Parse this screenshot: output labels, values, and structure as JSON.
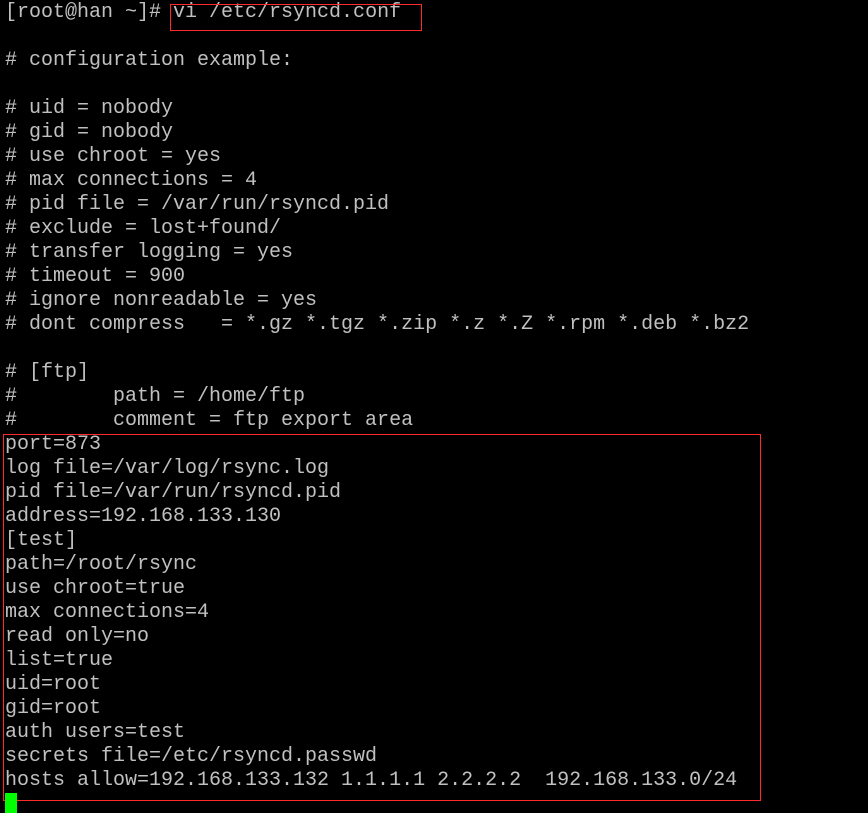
{
  "terminal": {
    "background": "#000000",
    "foreground": "#c0c0c0",
    "cursor_color": "#00ff00",
    "highlight_color": "#ff2a2a",
    "prompt": "[root@han ~]# ",
    "command": "vi /etc/rsyncd.conf",
    "lines": [
      "",
      "# configuration example:",
      "",
      "# uid = nobody",
      "# gid = nobody",
      "# use chroot = yes",
      "# max connections = 4",
      "# pid file = /var/run/rsyncd.pid",
      "# exclude = lost+found/",
      "# transfer logging = yes",
      "# timeout = 900",
      "# ignore nonreadable = yes",
      "# dont compress   = *.gz *.tgz *.zip *.z *.Z *.rpm *.deb *.bz2",
      "",
      "# [ftp]",
      "#        path = /home/ftp",
      "#        comment = ftp export area",
      "port=873",
      "log file=/var/log/rsync.log",
      "pid file=/var/run/rsyncd.pid",
      "address=192.168.133.130",
      "[test]",
      "path=/root/rsync",
      "use chroot=true",
      "max connections=4",
      "read only=no",
      "list=true",
      "uid=root",
      "gid=root",
      "auth users=test",
      "secrets file=/etc/rsyncd.passwd",
      "hosts allow=192.168.133.132 1.1.1.1 2.2.2.2  192.168.133.0/24"
    ]
  }
}
